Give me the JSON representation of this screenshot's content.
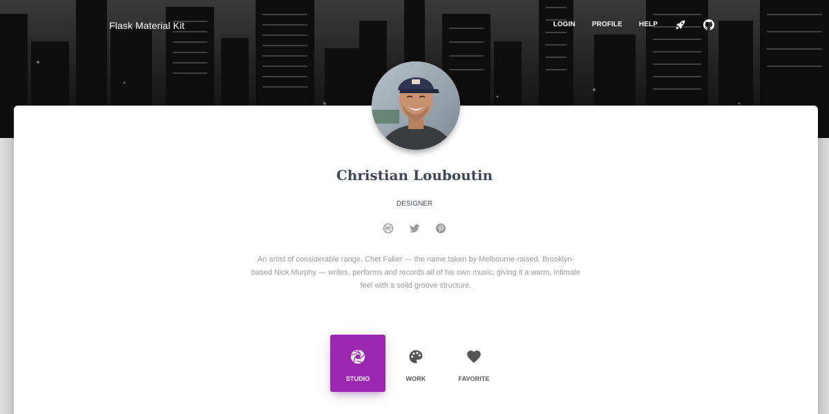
{
  "navbar": {
    "brand": "Flask Material Kit",
    "links": [
      {
        "label": "LOGIN"
      },
      {
        "label": "PROFILE"
      },
      {
        "label": "HELP"
      }
    ],
    "icons": [
      "rocket-icon",
      "github-icon"
    ]
  },
  "profile": {
    "name": "Christian Louboutin",
    "title": "DESIGNER",
    "socials": [
      "dribbble-icon",
      "twitter-icon",
      "pinterest-icon"
    ],
    "bio": "An artist of considerable range, Chet Faker — the name taken by Melbourne-raised, Brooklyn-based Nick Murphy — writes, performs and records all of his own music, giving it a warm, intimate feel with a solid groove structure."
  },
  "tabs": [
    {
      "label": "STUDIO",
      "icon": "camera-aperture-icon",
      "active": true
    },
    {
      "label": "WORK",
      "icon": "palette-icon",
      "active": false
    },
    {
      "label": "FAVORITE",
      "icon": "heart-icon",
      "active": false
    }
  ],
  "colors": {
    "accent": "#9c27b0",
    "heading": "#3c4858",
    "muted": "#999999"
  }
}
